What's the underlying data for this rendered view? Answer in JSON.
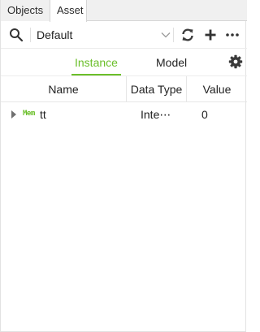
{
  "tabs": [
    {
      "label": "Objects"
    },
    {
      "label": "Asset"
    }
  ],
  "toolbar": {
    "search_icon": "search-icon",
    "selector_value": "Default",
    "refresh_icon": "refresh-icon",
    "add_icon": "plus-icon",
    "more_icon": "more-icon"
  },
  "modes": {
    "instance_label": "Instance",
    "model_label": "Model",
    "settings_icon": "gear-icon"
  },
  "table": {
    "headers": [
      "Name",
      "Data Type",
      "Value"
    ],
    "rows": [
      {
        "badge": "Mem",
        "name": "tt",
        "data_type": "Inte⋯",
        "value": "0"
      }
    ]
  },
  "colors": {
    "accent": "#6bbf2a"
  }
}
